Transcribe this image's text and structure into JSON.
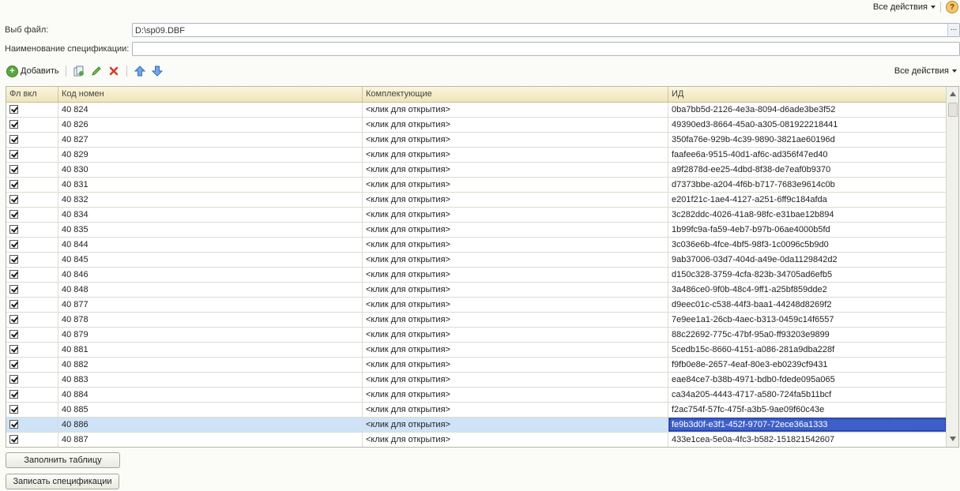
{
  "top": {
    "all_actions": "Все действия",
    "help": "?"
  },
  "form": {
    "file_label": "Выб файл:",
    "file_value": "D:\\sp09.DBF",
    "file_browse": "...",
    "spec_label": "Наименование спецификации:",
    "spec_value": ""
  },
  "toolbar": {
    "add_label": "Добавить",
    "all_actions": "Все действия"
  },
  "table": {
    "columns": [
      "Фл вкл",
      "Код номен",
      "Комплектующие",
      "ИД"
    ],
    "rows": [
      {
        "code": "40 824",
        "comp": "<клик для открытия>",
        "id": "0ba7bb5d-2126-4e3a-8094-d6ade3be3f52"
      },
      {
        "code": "40 826",
        "comp": "<клик для открытия>",
        "id": "49390ed3-8664-45a0-a305-081922218441"
      },
      {
        "code": "40 827",
        "comp": "<клик для открытия>",
        "id": "350fa76e-929b-4c39-9890-3821ae60196d"
      },
      {
        "code": "40 829",
        "comp": "<клик для открытия>",
        "id": "faafee6a-9515-40d1-af6c-ad356f47ed40"
      },
      {
        "code": "40 830",
        "comp": "<клик для открытия>",
        "id": "a9f2878d-ee25-4dbd-8f38-de7eaf0b9370"
      },
      {
        "code": "40 831",
        "comp": "<клик для открытия>",
        "id": "d7373bbe-a204-4f6b-b717-7683e9614c0b"
      },
      {
        "code": "40 832",
        "comp": "<клик для открытия>",
        "id": "e201f21c-1ae4-4127-a251-6ff9c184afda"
      },
      {
        "code": "40 834",
        "comp": "<клик для открытия>",
        "id": "3c282ddc-4026-41a8-98fc-e31bae12b894"
      },
      {
        "code": "40 835",
        "comp": "<клик для открытия>",
        "id": "1b99fc9a-fa59-4eb7-b97b-06ae4000b5fd"
      },
      {
        "code": "40 844",
        "comp": "<клик для открытия>",
        "id": "3c036e6b-4fce-4bf5-98f3-1c0096c5b9d0"
      },
      {
        "code": "40 845",
        "comp": "<клик для открытия>",
        "id": "9ab37006-03d7-404d-a49e-0da1129842d2"
      },
      {
        "code": "40 846",
        "comp": "<клик для открытия>",
        "id": "d150c328-3759-4cfa-823b-34705ad6efb5"
      },
      {
        "code": "40 848",
        "comp": "<клик для открытия>",
        "id": "3a486ce0-9f0b-48c4-9ff1-a25bf859dde2"
      },
      {
        "code": "40 877",
        "comp": "<клик для открытия>",
        "id": "d9eec01c-c538-44f3-baa1-44248d8269f2"
      },
      {
        "code": "40 878",
        "comp": "<клик для открытия>",
        "id": "7e9ee1a1-26cb-4aec-b313-0459c14f6557"
      },
      {
        "code": "40 879",
        "comp": "<клик для открытия>",
        "id": "88c22692-775c-47bf-95a0-ff93203e9899"
      },
      {
        "code": "40 881",
        "comp": "<клик для открытия>",
        "id": "5cedb15c-8660-4151-a086-281a9dba228f"
      },
      {
        "code": "40 882",
        "comp": "<клик для открытия>",
        "id": "f9fb0e8e-2657-4eaf-80e3-eb0239cf9431"
      },
      {
        "code": "40 883",
        "comp": "<клик для открытия>",
        "id": "eae84ce7-b38b-4971-bdb0-fdede095a065"
      },
      {
        "code": "40 884",
        "comp": "<клик для открытия>",
        "id": "ca34a205-4443-4717-a580-724fa5b11bcf"
      },
      {
        "code": "40 885",
        "comp": "<клик для открытия>",
        "id": "f2ac754f-57fc-475f-a3b5-9ae09f60c43e"
      },
      {
        "code": "40 886",
        "comp": "<клик для открытия>",
        "id": "fe9b3d0f-e3f1-452f-9707-72ece36a1333"
      },
      {
        "code": "40 887",
        "comp": "<клик для открытия>",
        "id": "433e1cea-5e0a-4fc3-b582-151821542607"
      }
    ]
  },
  "buttons": {
    "fill": "Заполнить таблицу",
    "save": "Записать спецификации"
  },
  "colors": {
    "selection_row": "#cfe3f7",
    "selection_cell": "#3e5fc9",
    "header": "#f3ead0"
  }
}
